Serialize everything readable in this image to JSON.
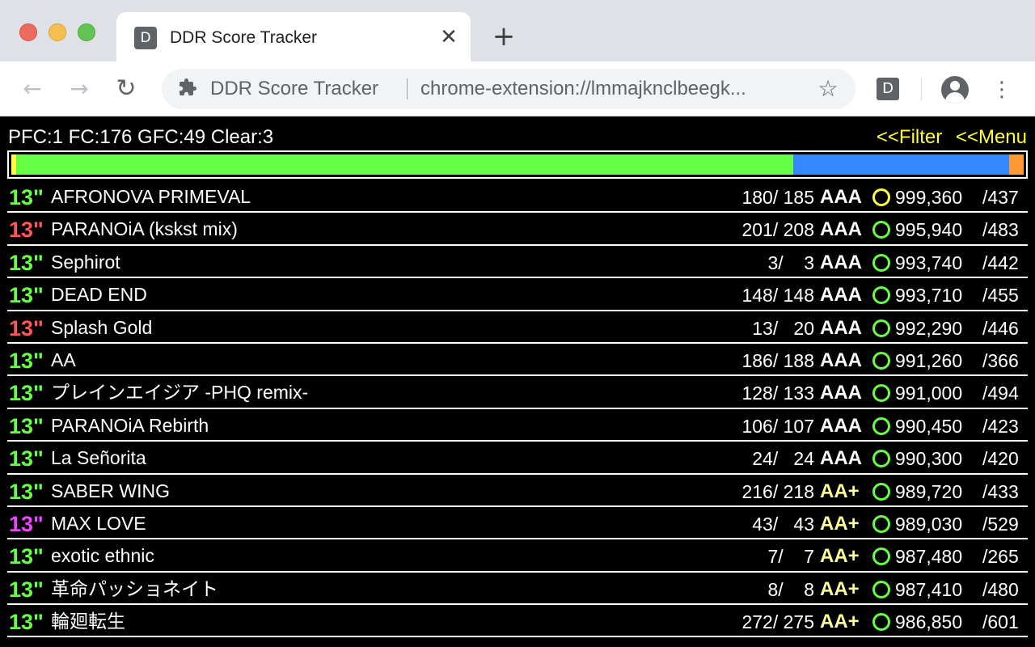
{
  "browser": {
    "tab_favicon_letter": "D",
    "tab_title": "DDR Score Tracker",
    "tab_close": "✕",
    "new_tab": "+",
    "back": "←",
    "forward": "→",
    "reload": "↻",
    "omnibox_site_name": "DDR Score Tracker",
    "omnibox_url": "chrome-extension://lmmajknclbeegk...",
    "bookmark_star": "☆",
    "extension_letter": "D",
    "menu": "⋮"
  },
  "summary": "PFC:1 FC:176 GFC:49 Clear:3",
  "links": {
    "filter": "<<Filter",
    "menu": "<<Menu"
  },
  "progress": {
    "segments": [
      {
        "label": "PFC",
        "fraction": 0.0045,
        "color": "#ffff44"
      },
      {
        "label": "GFC",
        "fraction": 0.7675,
        "color": "#66ff44"
      },
      {
        "label": "FC",
        "fraction": 0.2137,
        "color": "#3388ff"
      },
      {
        "label": "Clear",
        "fraction": 0.0143,
        "color": "#ff9933"
      }
    ]
  },
  "colors": {
    "level_green": "#66ff44",
    "level_red": "#ff5555",
    "level_magenta": "#ee44ff",
    "rank_aaa": "#ffffff",
    "rank_aaplus": "#ffff99",
    "lamp_gfc": "#66ff44",
    "lamp_pfc": "#ffff44"
  },
  "rows": [
    {
      "level": "13\"",
      "level_color": "#66ff44",
      "title": "AFRONOVA PRIMEVAL",
      "ex": "180/ 185",
      "rank": "AAA",
      "rank_color": "#ffffff",
      "lamp_color": "#ffff44",
      "score": "999,360",
      "total": "/437"
    },
    {
      "level": "13\"",
      "level_color": "#ff5555",
      "title": "PARANOiA (kskst mix)",
      "ex": "201/ 208",
      "rank": "AAA",
      "rank_color": "#ffffff",
      "lamp_color": "#66ff44",
      "score": "995,940",
      "total": "/483"
    },
    {
      "level": "13\"",
      "level_color": "#66ff44",
      "title": "Sephirot",
      "ex": "3/    3",
      "rank": "AAA",
      "rank_color": "#ffffff",
      "lamp_color": "#66ff44",
      "score": "993,740",
      "total": "/442"
    },
    {
      "level": "13\"",
      "level_color": "#66ff44",
      "title": "DEAD END",
      "ex": "148/ 148",
      "rank": "AAA",
      "rank_color": "#ffffff",
      "lamp_color": "#66ff44",
      "score": "993,710",
      "total": "/455"
    },
    {
      "level": "13\"",
      "level_color": "#ff5555",
      "title": "Splash Gold",
      "ex": "13/   20",
      "rank": "AAA",
      "rank_color": "#ffffff",
      "lamp_color": "#66ff44",
      "score": "992,290",
      "total": "/446"
    },
    {
      "level": "13\"",
      "level_color": "#66ff44",
      "title": "AA",
      "ex": "186/ 188",
      "rank": "AAA",
      "rank_color": "#ffffff",
      "lamp_color": "#66ff44",
      "score": "991,260",
      "total": "/366"
    },
    {
      "level": "13\"",
      "level_color": "#66ff44",
      "title": "プレインエイジア -PHQ remix-",
      "ex": "128/ 133",
      "rank": "AAA",
      "rank_color": "#ffffff",
      "lamp_color": "#66ff44",
      "score": "991,000",
      "total": "/494"
    },
    {
      "level": "13\"",
      "level_color": "#66ff44",
      "title": "PARANOiA Rebirth",
      "ex": "106/ 107",
      "rank": "AAA",
      "rank_color": "#ffffff",
      "lamp_color": "#66ff44",
      "score": "990,450",
      "total": "/423"
    },
    {
      "level": "13\"",
      "level_color": "#66ff44",
      "title": "La Señorita",
      "ex": "24/   24",
      "rank": "AAA",
      "rank_color": "#ffffff",
      "lamp_color": "#66ff44",
      "score": "990,300",
      "total": "/420"
    },
    {
      "level": "13\"",
      "level_color": "#66ff44",
      "title": "SABER WING",
      "ex": "216/ 218",
      "rank": "AA+",
      "rank_color": "#ffff99",
      "lamp_color": "#66ff44",
      "score": "989,720",
      "total": "/433"
    },
    {
      "level": "13\"",
      "level_color": "#ee44ff",
      "title": "MAX LOVE",
      "ex": "43/   43",
      "rank": "AA+",
      "rank_color": "#ffff99",
      "lamp_color": "#66ff44",
      "score": "989,030",
      "total": "/529"
    },
    {
      "level": "13\"",
      "level_color": "#66ff44",
      "title": "exotic ethnic",
      "ex": "7/    7",
      "rank": "AA+",
      "rank_color": "#ffff99",
      "lamp_color": "#66ff44",
      "score": "987,480",
      "total": "/265"
    },
    {
      "level": "13\"",
      "level_color": "#66ff44",
      "title": "革命パッショネイト",
      "ex": "8/    8",
      "rank": "AA+",
      "rank_color": "#ffff99",
      "lamp_color": "#66ff44",
      "score": "987,410",
      "total": "/480"
    },
    {
      "level": "13\"",
      "level_color": "#66ff44",
      "title": "輪廻転生",
      "ex": "272/ 275",
      "rank": "AA+",
      "rank_color": "#ffff99",
      "lamp_color": "#66ff44",
      "score": "986,850",
      "total": "/601"
    }
  ]
}
